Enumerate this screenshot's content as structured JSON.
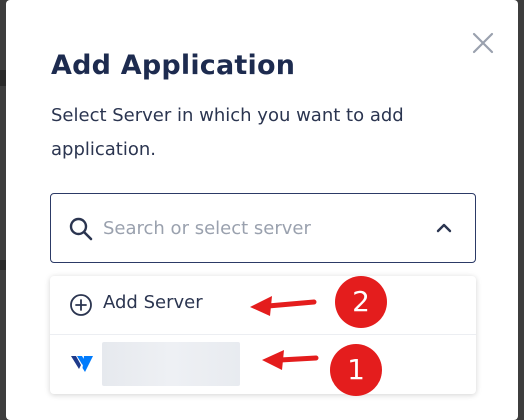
{
  "modal": {
    "title": "Add Application",
    "subtitle": "Select Server in which you want to add application."
  },
  "search": {
    "placeholder": "Search or select server",
    "value": ""
  },
  "dropdown": {
    "items": [
      {
        "label": "Add Server",
        "icon": "plus-circle-icon"
      },
      {
        "label": "",
        "icon": "vultr-logo-icon",
        "name_redacted": true
      }
    ]
  },
  "annotations": {
    "badge_add_server": "2",
    "badge_server": "1"
  },
  "colors": {
    "title": "#1d2b4f",
    "text": "#2b3550",
    "placeholder": "#9aa1ae",
    "border": "#2c3a66",
    "annotation": "#e41d1d",
    "vultr_primary": "#007bfc",
    "vultr_dark": "#1e3a8a"
  }
}
